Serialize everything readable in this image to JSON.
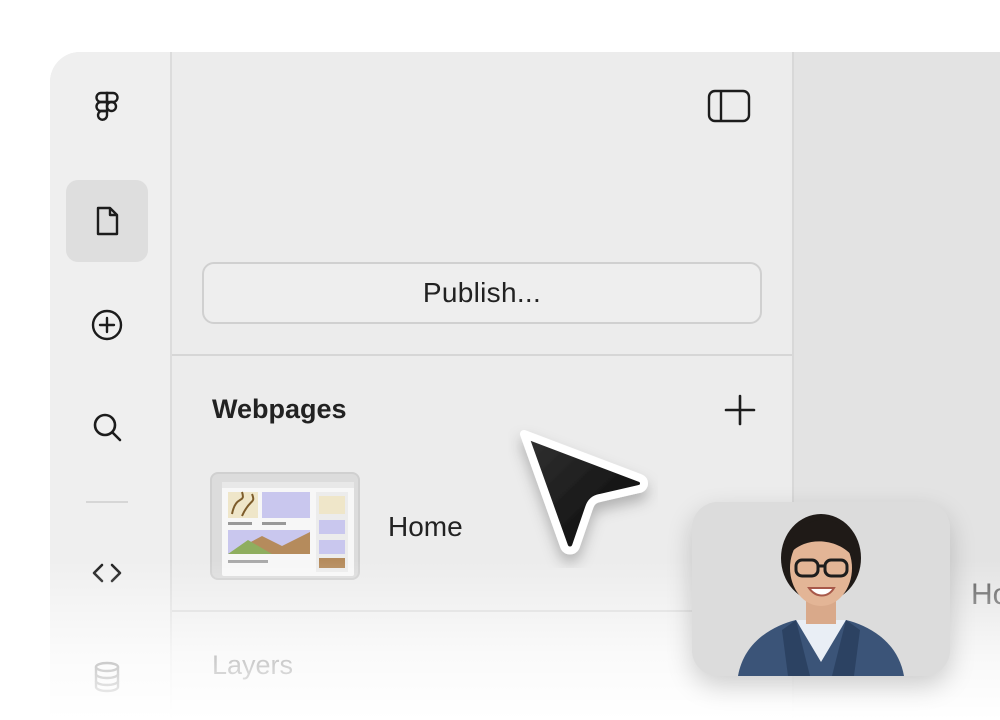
{
  "rail": {
    "items": [
      {
        "icon": "figma-logo-icon"
      },
      {
        "icon": "file-icon",
        "active": true
      },
      {
        "icon": "plus-circle-icon"
      },
      {
        "icon": "search-icon"
      },
      {
        "icon": "code-icon"
      },
      {
        "icon": "database-icon"
      }
    ]
  },
  "panel": {
    "toggle_icon": "sidebar-toggle-icon",
    "publish_label": "Publish...",
    "webpages_title": "Webpages",
    "add_icon": "plus-icon",
    "pages": [
      {
        "label": "Home"
      }
    ],
    "layers_title": "Layers"
  },
  "canvas": {
    "partial_text": "Ho"
  },
  "colors": {
    "background": "#ffffff",
    "panel": "#ececec",
    "canvas": "#e3e3e3",
    "cursor": "#111111"
  }
}
